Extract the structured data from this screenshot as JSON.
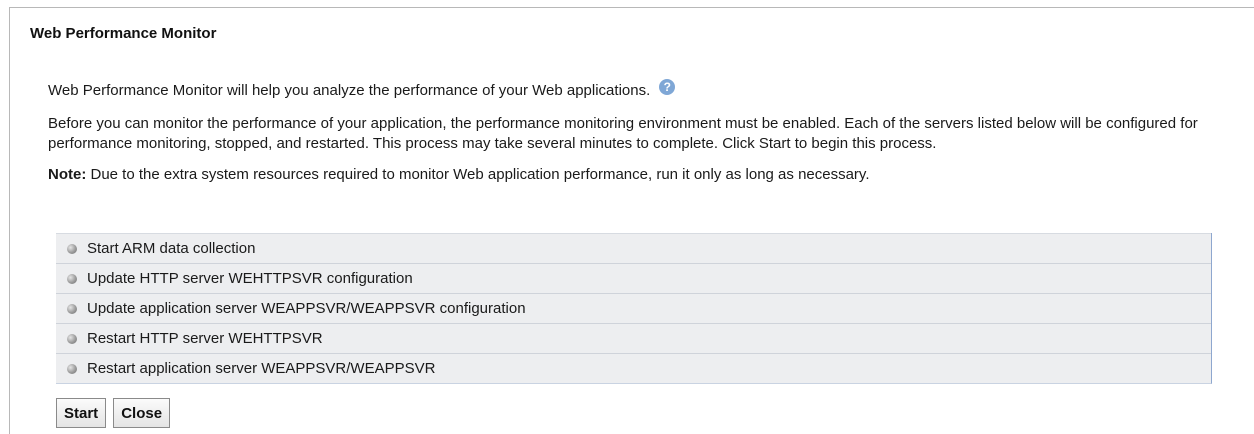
{
  "panel": {
    "title": "Web Performance Monitor"
  },
  "intro": {
    "text": "Web Performance Monitor will help you analyze the performance of your Web applications.",
    "help_icon": "help-question-icon"
  },
  "description": "Before you can monitor the performance of your application, the performance monitoring environment must be enabled. Each of the servers listed below will be configured for performance monitoring, stopped, and restarted. This process may take several minutes to complete. Click Start to begin this process.",
  "note": {
    "label": "Note:",
    "text": " Due to the extra system resources required to monitor Web application performance, run it only as long as necessary."
  },
  "steps": [
    {
      "label": "Start ARM data collection"
    },
    {
      "label": "Update HTTP server WEHTTPSVR configuration"
    },
    {
      "label": "Update application server WEAPPSVR/WEAPPSVR configuration"
    },
    {
      "label": "Restart HTTP server WEHTTPSVR"
    },
    {
      "label": "Restart application server WEAPPSVR/WEAPPSVR"
    }
  ],
  "buttons": {
    "start_label": "Start",
    "close_label": "Close"
  },
  "colors": {
    "step_background": "#edeef0",
    "help_icon": "#7fa7d6",
    "list_border": "#8ea7cf"
  }
}
